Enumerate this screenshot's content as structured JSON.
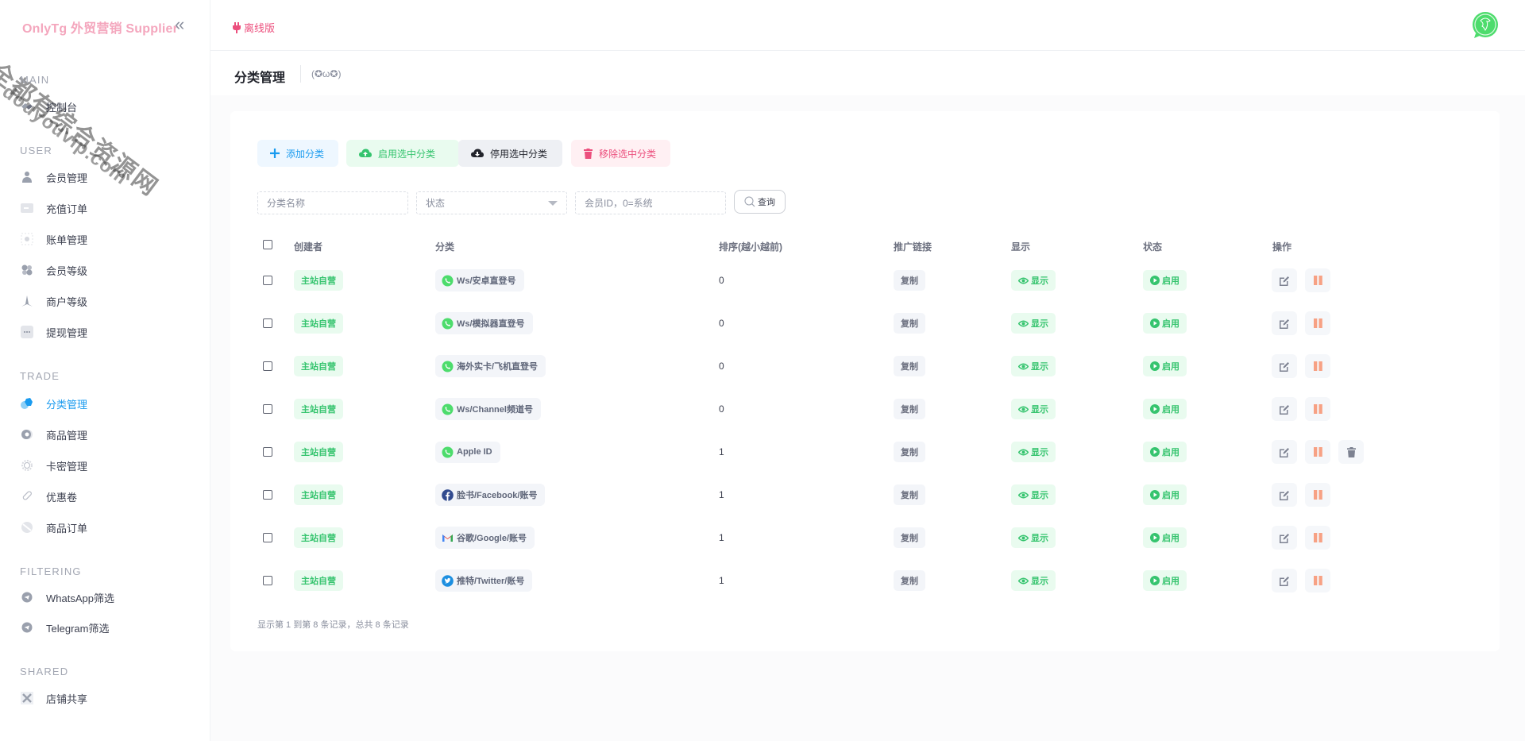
{
  "sidebar": {
    "brand": "OnlyTg 外贸营销 Supplier",
    "watermark_line1": "全都有综合资源网",
    "watermark_line2": "douyouvip.com",
    "sections": [
      {
        "title": "MAIN",
        "items": [
          {
            "label": "控制台",
            "icon": "dashboard-icon"
          }
        ]
      },
      {
        "title": "USER",
        "items": [
          {
            "label": "会员管理",
            "icon": "user-icon"
          },
          {
            "label": "充值订单",
            "icon": "wallet-icon"
          },
          {
            "label": "账单管理",
            "icon": "bill-icon"
          },
          {
            "label": "会员等级",
            "icon": "fan-icon"
          },
          {
            "label": "商户等级",
            "icon": "star-icon"
          },
          {
            "label": "提现管理",
            "icon": "more-icon"
          }
        ]
      },
      {
        "title": "TRADE",
        "items": [
          {
            "label": "分类管理",
            "icon": "category-icon",
            "active": true
          },
          {
            "label": "商品管理",
            "icon": "product-icon"
          },
          {
            "label": "卡密管理",
            "icon": "gear-icon"
          },
          {
            "label": "优惠卷",
            "icon": "coupon-icon"
          },
          {
            "label": "商品订单",
            "icon": "order-icon"
          }
        ]
      },
      {
        "title": "FILTERING",
        "items": [
          {
            "label": "WhatsApp筛选",
            "icon": "send-icon"
          },
          {
            "label": "Telegram筛选",
            "icon": "send-icon"
          }
        ]
      },
      {
        "title": "SHARED",
        "items": [
          {
            "label": "店铺共享",
            "icon": "share-icon"
          }
        ]
      }
    ]
  },
  "topbar": {
    "mode_label": "离线版",
    "avatar_icon": "whatsapp-avatar-icon"
  },
  "page": {
    "title": "分类管理",
    "subtitle": "(✪ω✪)"
  },
  "toolbar": {
    "add_label": "添加分类",
    "enable_label": "启用选中分类",
    "disable_label": "停用选中分类",
    "remove_label": "移除选中分类"
  },
  "filters": {
    "name_placeholder": "分类名称",
    "status_placeholder": "状态",
    "member_placeholder": "会员ID，0=系统",
    "search_label": "查询"
  },
  "table": {
    "columns": [
      "创建者",
      "分类",
      "排序(越小越前)",
      "推广链接",
      "显示",
      "状态",
      "操作"
    ],
    "rows": [
      {
        "creator": "主站自营",
        "category": "Ws/安卓直登号",
        "icon": "whatsapp",
        "sort": "0",
        "link": "复制",
        "display": "显示",
        "status": "启用",
        "deletable": false
      },
      {
        "creator": "主站自营",
        "category": "Ws/模拟器直登号",
        "icon": "whatsapp",
        "sort": "0",
        "link": "复制",
        "display": "显示",
        "status": "启用",
        "deletable": false
      },
      {
        "creator": "主站自营",
        "category": "海外实卡/飞机直登号",
        "icon": "whatsapp",
        "sort": "0",
        "link": "复制",
        "display": "显示",
        "status": "启用",
        "deletable": false
      },
      {
        "creator": "主站自营",
        "category": "Ws/Channel频道号",
        "icon": "whatsapp",
        "sort": "0",
        "link": "复制",
        "display": "显示",
        "status": "启用",
        "deletable": false
      },
      {
        "creator": "主站自营",
        "category": "Apple ID",
        "icon": "whatsapp",
        "sort": "1",
        "link": "复制",
        "display": "显示",
        "status": "启用",
        "deletable": true
      },
      {
        "creator": "主站自营",
        "category": "脸书/Facebook/账号",
        "icon": "facebook",
        "sort": "1",
        "link": "复制",
        "display": "显示",
        "status": "启用",
        "deletable": false
      },
      {
        "creator": "主站自营",
        "category": "谷歌/Google/账号",
        "icon": "gmail",
        "sort": "1",
        "link": "复制",
        "display": "显示",
        "status": "启用",
        "deletable": false
      },
      {
        "creator": "主站自营",
        "category": "推特/Twitter/账号",
        "icon": "twitter",
        "sort": "1",
        "link": "复制",
        "display": "显示",
        "status": "启用",
        "deletable": false
      }
    ],
    "footer": "显示第 1 到第 8 条记录，总共 8 条记录"
  },
  "colors": {
    "accent": "#1a9bef",
    "success": "#35c46e",
    "danger": "#ec4f7d",
    "pause": "#f7a184",
    "brand": "#f4a6bd"
  }
}
